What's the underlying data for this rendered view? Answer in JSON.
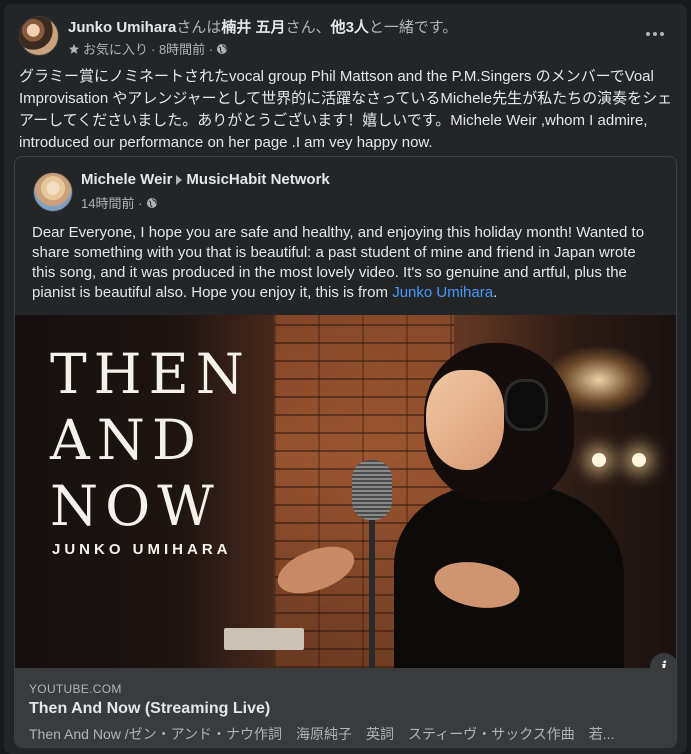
{
  "post": {
    "author": "Junko Umihara",
    "with_text_1": "さんは",
    "tagged_person": "楠井 五月",
    "with_text_2": "さん、",
    "others": "他3人",
    "with_text_3": "と一緒です。",
    "favorite_label": "お気に入り",
    "time": "· 8時間前 ·",
    "privacy_icon": "globe-icon",
    "body": "グラミー賞にノミネートされたvocal group Phil Mattson and the P.M.Singers のメンバーでVoal Improvisation やアレンジャーとして世界的に活躍なさっているMichele先生が私たちの演奏をシェアーしてくださいました。ありがとうございます！嬉しいです。Michele Weir ,whom I admire, introduced our performance on her page .I am vey happy now."
  },
  "shared": {
    "author": "Michele Weir",
    "page": "MusicHabit Network",
    "time": "14時間前 ·",
    "body": "Dear Everyone, I hope you are safe and healthy, and enjoying this holiday month! Wanted to share something with you that is beautiful: a past student of mine and friend in Japan wrote this song, and it was produced in the most lovely video. It's so genuine and artful, plus the pianist is beautiful also. Hope you enjoy it, this is from ",
    "mention": "Junko  Umihara",
    "body_end": "."
  },
  "video": {
    "title_art": "THEN\nAND\nNOW",
    "artist_art": "JUNKO UMIHARA",
    "info_label": "i"
  },
  "link": {
    "source": "YOUTUBE.COM",
    "title": "Then And Now (Streaming Live)",
    "description": "Then And Now /ゼン・アンド・ナウ作詞　海原純子　英詞　スティーヴ・サックス作曲　若..."
  },
  "colors": {
    "background": "#18191a",
    "card": "#242526",
    "link": "#4599ff",
    "muted": "#b0b3b8"
  }
}
